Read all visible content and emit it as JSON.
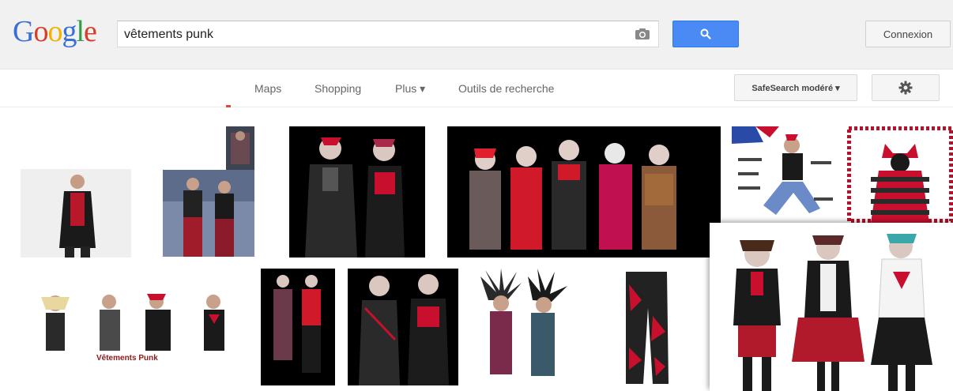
{
  "header": {
    "logo_letters": [
      "G",
      "o",
      "o",
      "g",
      "l",
      "e"
    ],
    "logo_colors": [
      "#3a6fd8",
      "#d5402b",
      "#f0b400",
      "#3a6fd8",
      "#2f9e44",
      "#d5402b"
    ],
    "search_value": "vêtements punk",
    "camera_icon": "camera-icon",
    "search_icon": "search-icon",
    "connexion_label": "Connexion"
  },
  "nav": {
    "items": [
      "Maps",
      "Shopping",
      "Plus ▾",
      "Outils de recherche"
    ],
    "safesearch_label": "SafeSearch modéré ▾",
    "settings_icon": "gear-icon"
  },
  "results": {
    "caption": "Vêtements Punk"
  },
  "colors": {
    "search_blue": "#4a8af4",
    "accent_red": "#dd4b39",
    "punk_red": "#c8102e"
  }
}
